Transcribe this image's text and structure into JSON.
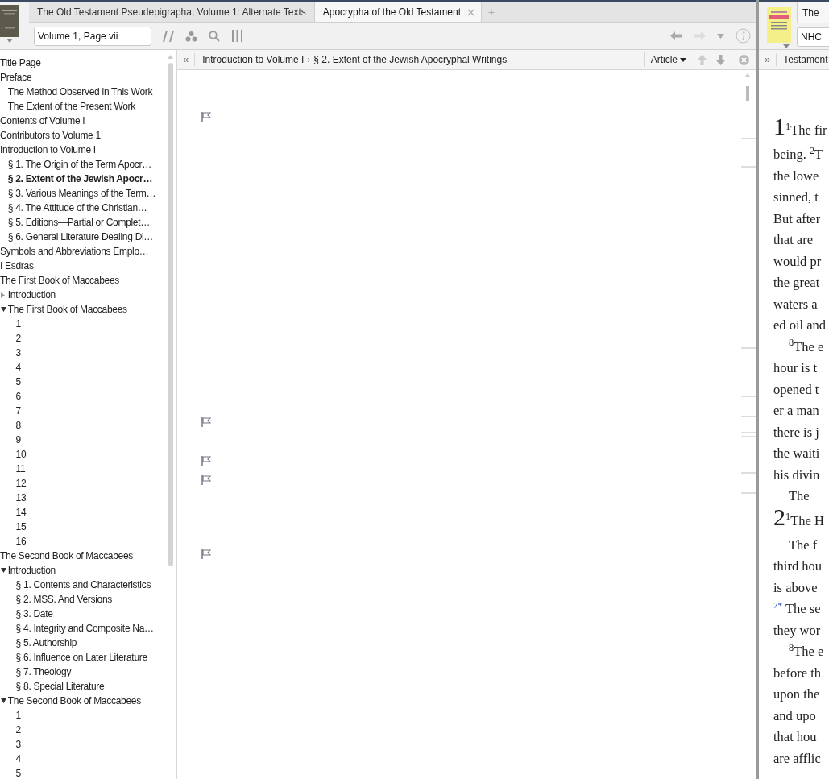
{
  "left_pane": {
    "tabs": [
      {
        "label": "The Old Testament Pseudepigrapha, Volume 1: Alternate Texts",
        "selected": false
      },
      {
        "label": "Apocrypha of the Old Testament",
        "selected": true
      }
    ],
    "new_tab": "+",
    "reference_field": {
      "value": "Volume 1, Page vii"
    },
    "navigation": {
      "back_disabled": false,
      "forward_disabled": true
    },
    "toc": [
      {
        "label": "Title Page",
        "selected": false
      },
      {
        "label": "Preface",
        "selected": false,
        "children": [
          {
            "label": "The Method Observed in This Work",
            "selected": false
          },
          {
            "label": "The Extent of the Present Work",
            "selected": false
          }
        ]
      },
      {
        "label": "Contents of Volume I",
        "selected": false
      },
      {
        "label": "Contributors to Volume 1",
        "selected": false
      },
      {
        "label": "Introduction to Volume I",
        "selected": false,
        "children": [
          {
            "label": "§ 1. The Origin of the Term Apocr…",
            "selected": false
          },
          {
            "label": "§ 2. Extent of the Jewish Apocr…",
            "selected": true
          },
          {
            "label": "§ 3. Various Meanings of the Term…",
            "selected": false
          },
          {
            "label": "§ 4. The Attitude of the Christian…",
            "selected": false
          },
          {
            "label": "§ 5. Editions—Partial or Complet…",
            "selected": false
          },
          {
            "label": "§ 6. General Literature Dealing Di…",
            "selected": false
          }
        ]
      },
      {
        "label": "Symbols and Abbreviations Emplo…",
        "selected": false
      },
      {
        "label": "I Esdras",
        "selected": false
      },
      {
        "label": "The First Book of Maccabees",
        "selected": false,
        "children": [
          {
            "label": "Introduction",
            "selected": false,
            "expanded": false
          },
          {
            "label": "The First Book of Maccabees",
            "selected": false,
            "expanded": true,
            "children": [
              {
                "label": "1",
                "selected": false
              },
              {
                "label": "2",
                "selected": false
              },
              {
                "label": "3",
                "selected": false
              },
              {
                "label": "4",
                "selected": false
              },
              {
                "label": "5",
                "selected": false
              },
              {
                "label": "6",
                "selected": false
              },
              {
                "label": "7",
                "selected": false
              },
              {
                "label": "8",
                "selected": false
              },
              {
                "label": "9",
                "selected": false
              },
              {
                "label": "10",
                "selected": false
              },
              {
                "label": "11",
                "selected": false
              },
              {
                "label": "12",
                "selected": false
              },
              {
                "label": "13",
                "selected": false
              },
              {
                "label": "14",
                "selected": false
              },
              {
                "label": "15",
                "selected": false
              },
              {
                "label": "16",
                "selected": false
              }
            ]
          }
        ]
      },
      {
        "label": "The Second Book of Maccabees",
        "selected": false,
        "children": [
          {
            "label": "Introduction",
            "selected": false,
            "expanded": true,
            "children": [
              {
                "label": "§ 1. Contents and Characteristics",
                "selected": false
              },
              {
                "label": "§ 2. MSS. And Versions",
                "selected": false
              },
              {
                "label": "§ 3. Date",
                "selected": false
              },
              {
                "label": "§ 4. Integrity and Composite Na…",
                "selected": false
              },
              {
                "label": "§ 5. Authorship",
                "selected": false
              },
              {
                "label": "§ 6. Influence on Later Literature",
                "selected": false
              },
              {
                "label": "§ 7. Theology",
                "selected": false
              },
              {
                "label": "§ 8. Special Literature",
                "selected": false
              }
            ]
          },
          {
            "label": "The Second Book of Maccabees",
            "selected": false,
            "expanded": true,
            "children": [
              {
                "label": "1",
                "selected": false
              },
              {
                "label": "2",
                "selected": false
              },
              {
                "label": "3",
                "selected": false
              },
              {
                "label": "4",
                "selected": false
              },
              {
                "label": "5",
                "selected": false
              }
            ]
          }
        ]
      }
    ],
    "breadcrumb": {
      "collapse": "«",
      "items": [
        "Introduction to Volume I",
        "§ 2. Extent of the Jewish Apocryphal Writings"
      ],
      "separator": "›",
      "view_menu": "Article"
    }
  },
  "right_pane": {
    "tab": "The",
    "field_value": "NHC",
    "collapse": "»",
    "breadcrumb": "Testament",
    "lines": [
      {
        "kind": "chapter",
        "number": "1",
        "text": "$^{1}$The fir"
      },
      {
        "kind": "line",
        "text": "being. $^{2}$T"
      },
      {
        "kind": "line",
        "text": "the lowe"
      },
      {
        "kind": "line",
        "text": "sinned, t"
      },
      {
        "kind": "line",
        "text": "But after"
      },
      {
        "kind": "line",
        "text": "that are"
      },
      {
        "kind": "line",
        "text": "would pr"
      },
      {
        "kind": "line",
        "text": "the great"
      },
      {
        "kind": "line",
        "text": "waters a"
      },
      {
        "kind": "line",
        "text": "ed oil and"
      },
      {
        "kind": "indent",
        "text": "$^{8}$The e"
      },
      {
        "kind": "line",
        "text": "hour is t"
      },
      {
        "kind": "line",
        "text": "opened t"
      },
      {
        "kind": "line",
        "text": "er a man"
      },
      {
        "kind": "line",
        "text": "there is j"
      },
      {
        "kind": "line",
        "text": "the waiti"
      },
      {
        "kind": "line",
        "text": "his divin"
      },
      {
        "kind": "indent",
        "text": "The"
      },
      {
        "kind": "chapter",
        "number": "2",
        "text": "$^{1}$The H"
      },
      {
        "kind": "indent",
        "text": "The f"
      },
      {
        "kind": "line",
        "text": "third hou"
      },
      {
        "kind": "line",
        "text": "is above"
      },
      {
        "kind": "note",
        "marker": "7*",
        "text": "The se"
      },
      {
        "kind": "line",
        "text": "they wor"
      },
      {
        "kind": "indent",
        "text": "$^{8}$The e"
      },
      {
        "kind": "line",
        "text": "before th"
      },
      {
        "kind": "line",
        "text": "upon the"
      },
      {
        "kind": "line",
        "text": "and upo"
      },
      {
        "kind": "line",
        "text": "that hou"
      },
      {
        "kind": "line",
        "text": "are afflic"
      }
    ]
  }
}
